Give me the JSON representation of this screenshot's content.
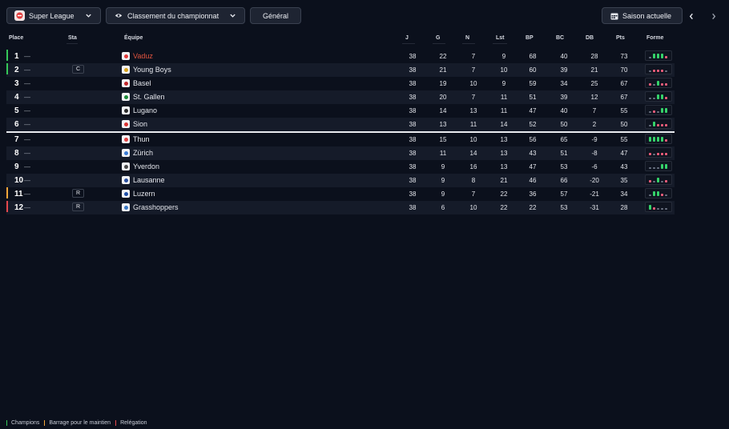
{
  "toolbar": {
    "league_label": "Super League",
    "view_label": "Classement du championnat",
    "scope_label": "Général",
    "season_label": "Saison actuelle"
  },
  "table": {
    "headers": [
      "Place",
      "Sta",
      "Équipe",
      "J",
      "G",
      "N",
      "Lst",
      "BP",
      "BC",
      "DB",
      "Pts",
      "Forme"
    ],
    "rows": [
      {
        "place": "1",
        "move": "—",
        "status": "",
        "team": "Vaduz",
        "j": "38",
        "g": "22",
        "n": "7",
        "lst": "9",
        "bp": "68",
        "bc": "40",
        "db": "28",
        "pts": "73",
        "qualifier": "champions",
        "highlight": true,
        "form": [
          "D",
          "W",
          "W",
          "W",
          "L"
        ],
        "crest": "#e03a3a"
      },
      {
        "place": "2",
        "move": "—",
        "status": "C",
        "team": "Young Boys",
        "j": "38",
        "g": "21",
        "n": "7",
        "lst": "10",
        "bp": "60",
        "bc": "39",
        "db": "21",
        "pts": "70",
        "qualifier": "champions",
        "highlight": false,
        "form": [
          "D",
          "L",
          "L",
          "L",
          "D"
        ],
        "crest": "#d9a21a"
      },
      {
        "place": "3",
        "move": "—",
        "status": "",
        "team": "Basel",
        "j": "38",
        "g": "19",
        "n": "10",
        "lst": "9",
        "bp": "59",
        "bc": "34",
        "db": "25",
        "pts": "67",
        "qualifier": "",
        "highlight": false,
        "form": [
          "L",
          "D",
          "W",
          "L",
          "L"
        ],
        "crest": "#c2262b"
      },
      {
        "place": "4",
        "move": "—",
        "status": "",
        "team": "St. Gallen",
        "j": "38",
        "g": "20",
        "n": "7",
        "lst": "11",
        "bp": "51",
        "bc": "39",
        "db": "12",
        "pts": "67",
        "qualifier": "",
        "highlight": false,
        "form": [
          "D",
          "D",
          "W",
          "W",
          "L"
        ],
        "crest": "#1d8a3a"
      },
      {
        "place": "5",
        "move": "—",
        "status": "",
        "team": "Lugano",
        "j": "38",
        "g": "14",
        "n": "13",
        "lst": "11",
        "bp": "47",
        "bc": "40",
        "db": "7",
        "pts": "55",
        "qualifier": "",
        "highlight": false,
        "form": [
          "D",
          "L",
          "D",
          "W",
          "W"
        ],
        "crest": "#2a2a2a"
      },
      {
        "place": "6",
        "move": "—",
        "status": "",
        "team": "Sion",
        "j": "38",
        "g": "13",
        "n": "11",
        "lst": "14",
        "bp": "52",
        "bc": "50",
        "db": "2",
        "pts": "50",
        "qualifier": "",
        "highlight": false,
        "form": [
          "D",
          "W",
          "L",
          "L",
          "L"
        ],
        "crest": "#d93333"
      },
      {
        "place": "7",
        "move": "—",
        "status": "",
        "team": "Thun",
        "j": "38",
        "g": "15",
        "n": "10",
        "lst": "13",
        "bp": "56",
        "bc": "65",
        "db": "-9",
        "pts": "55",
        "qualifier": "",
        "highlight": false,
        "form": [
          "W",
          "W",
          "W",
          "W",
          "L"
        ],
        "crest": "#e04040"
      },
      {
        "place": "8",
        "move": "—",
        "status": "",
        "team": "Zürich",
        "j": "38",
        "g": "11",
        "n": "14",
        "lst": "13",
        "bp": "43",
        "bc": "51",
        "db": "-8",
        "pts": "47",
        "qualifier": "",
        "highlight": false,
        "form": [
          "L",
          "D",
          "L",
          "L",
          "L"
        ],
        "crest": "#3a7bd5"
      },
      {
        "place": "9",
        "move": "—",
        "status": "",
        "team": "Yverdon",
        "j": "38",
        "g": "9",
        "n": "16",
        "lst": "13",
        "bp": "47",
        "bc": "53",
        "db": "-6",
        "pts": "43",
        "qualifier": "",
        "highlight": false,
        "form": [
          "D",
          "D",
          "D",
          "W",
          "W"
        ],
        "crest": "#4a4a4a"
      },
      {
        "place": "10",
        "move": "—",
        "status": "",
        "team": "Lausanne",
        "j": "38",
        "g": "9",
        "n": "8",
        "lst": "21",
        "bp": "46",
        "bc": "66",
        "db": "-20",
        "pts": "35",
        "qualifier": "",
        "highlight": false,
        "form": [
          "L",
          "D",
          "W",
          "D",
          "L"
        ],
        "crest": "#2a4fa0"
      },
      {
        "place": "11",
        "move": "—",
        "status": "R",
        "team": "Luzern",
        "j": "38",
        "g": "9",
        "n": "7",
        "lst": "22",
        "bp": "36",
        "bc": "57",
        "db": "-21",
        "pts": "34",
        "qualifier": "playoff",
        "highlight": false,
        "form": [
          "D",
          "W",
          "W",
          "L",
          "D"
        ],
        "crest": "#1f4fa8"
      },
      {
        "place": "12",
        "move": "—",
        "status": "R",
        "team": "Grasshoppers",
        "j": "38",
        "g": "6",
        "n": "10",
        "lst": "22",
        "bp": "22",
        "bc": "53",
        "db": "-31",
        "pts": "28",
        "qualifier": "relegation",
        "highlight": false,
        "form": [
          "W",
          "L",
          "D",
          "D",
          "D"
        ],
        "crest": "#3b78c4"
      }
    ]
  },
  "legend": [
    {
      "label": "Champions",
      "color": "#35c759"
    },
    {
      "label": "Barrage pour le maintien",
      "color": "#f4a63a"
    },
    {
      "label": "Relégation",
      "color": "#e5484d"
    }
  ],
  "colors": {
    "background": "#0b101c",
    "row_alt": "#151b29",
    "button": "#1e2432",
    "win": "#35d36a",
    "loss": "#f25d7b",
    "draw": "#6c7384",
    "highlight": "#e2543f",
    "champions": "#35c759",
    "playoff": "#f4a63a",
    "relegation": "#e5484d"
  },
  "icons": {
    "league": "league-logo",
    "view": "eye-icon",
    "season": "calendar-icon",
    "prev": "chevron-left-icon",
    "next": "chevron-right-icon"
  }
}
